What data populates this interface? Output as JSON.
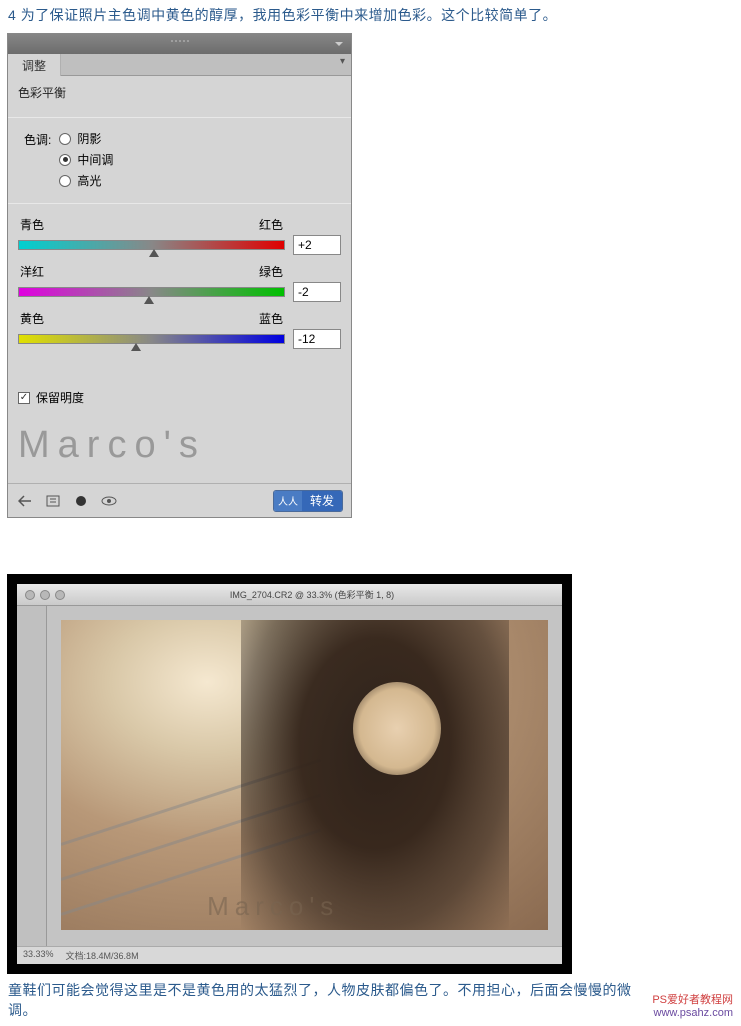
{
  "intro": {
    "num": "4",
    "text": "为了保证照片主色调中黄色的醇厚，我用色彩平衡中来增加色彩。这个比较简单了。"
  },
  "panel": {
    "tab": "调整",
    "title": "色彩平衡",
    "tone_label": "色调:",
    "tone_options": {
      "shadow": "阴影",
      "midtone": "中间调",
      "highlight": "高光"
    },
    "sliders": {
      "s1": {
        "left": "青色",
        "right": "红色",
        "value": "+2"
      },
      "s2": {
        "left": "洋红",
        "right": "绿色",
        "value": "-2"
      },
      "s3": {
        "left": "黄色",
        "right": "蓝色",
        "value": "-12"
      }
    },
    "preserve": "保留明度",
    "watermark": "Marco's",
    "share_label": "转发"
  },
  "doc_window": {
    "title": "IMG_2704.CR2 @ 33.3% (色彩平衡 1, 8)",
    "zoom": "33.33%",
    "info": "文档:18.4M/36.8M",
    "photo_mark": "Marco's"
  },
  "outro": {
    "text": "童鞋们可能会觉得这里是不是黄色用的太猛烈了，人物皮肤都偏色了。不用担心，后面会慢慢的微调。",
    "brand_cn": "PS爱好者教程网",
    "brand_url": "www.psahz.com"
  }
}
